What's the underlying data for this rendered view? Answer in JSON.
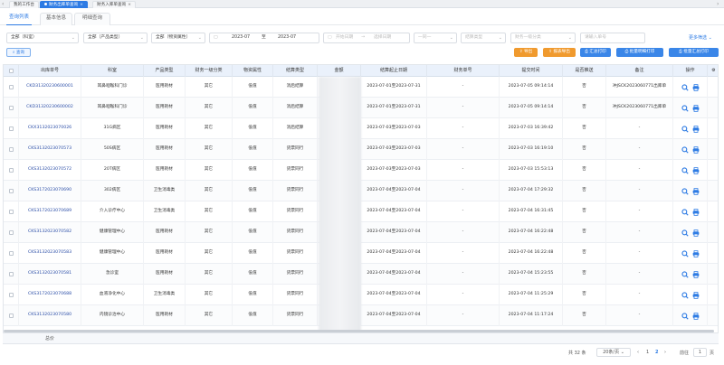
{
  "top_tabs": [
    {
      "label": "我的工作台"
    },
    {
      "label": "财务出库单查询"
    },
    {
      "label": "财务入库单查询"
    }
  ],
  "sub_tabs": [
    {
      "label": "查询列表"
    },
    {
      "label": "基本信息"
    },
    {
      "label": "明细查询"
    }
  ],
  "filters": {
    "dept": "全部（科室）",
    "product_type": "全部（产品类型）",
    "material": "全部（物资属性）",
    "date_from": "2023-07",
    "date_sep": "至",
    "date_to": "2023-07",
    "start_date_ph": "开始日期",
    "end_date_ph": "选择日期",
    "date_sep2": "→",
    "fuzzy_ph": "一同一",
    "settle_ph": "结算类型",
    "finance_cat_ph": "财务一级分类",
    "search_ph": "请输入单号",
    "more_filter": "更多筛选"
  },
  "actions": {
    "query": "查询",
    "export": "导出",
    "report_export": "报表导出",
    "summary_print": "汇总打印",
    "batch_detail_print": "批量明细打印",
    "batch_summary_print": "批量汇总打印"
  },
  "table": {
    "columns": [
      "出库单号",
      "科室",
      "产品类型",
      "财务一级分类",
      "物资属性",
      "结算类型",
      "金额",
      "结算起止日期",
      "财务单号",
      "提交时间",
      "是否推送",
      "备注",
      "操作"
    ],
    "rows": [
      {
        "no": "CKD31320230600001",
        "dept": "耳鼻咽喉科门诊",
        "ptype": "医用耗材",
        "fin": "其它",
        "attr": "低值",
        "settle": "消后结算",
        "range": "2023-07-01至2023-07-31",
        "finno": "-",
        "time": "2023-07-05 09:14:14",
        "push": "否",
        "remark": "冲JSCK2023060771出库单"
      },
      {
        "no": "CKD31320230600002",
        "dept": "耳鼻咽喉科门诊",
        "ptype": "医用耗材",
        "fin": "其它",
        "attr": "低值",
        "settle": "消后结算",
        "range": "2023-07-01至2023-07-31",
        "finno": "-",
        "time": "2023-07-05 09:14:14",
        "push": "否",
        "remark": "冲JSCK2023060771出库单"
      },
      {
        "no": "CKX3132023070026",
        "dept": "31G病区",
        "ptype": "医用耗材",
        "fin": "其它",
        "attr": "低值",
        "settle": "消后结算",
        "range": "2023-07-03至2023-07-03",
        "finno": "-",
        "time": "2023-07-03 16:39:42",
        "push": "否",
        "remark": "-"
      },
      {
        "no": "CKS3132023070573",
        "dept": "50S病区",
        "ptype": "医用耗材",
        "fin": "其它",
        "attr": "低值",
        "settle": "货票同行",
        "range": "2023-07-03至2023-07-03",
        "finno": "-",
        "time": "2023-07-03 16:19:10",
        "push": "否",
        "remark": "-"
      },
      {
        "no": "CKS3132023070572",
        "dept": "20T病区",
        "ptype": "医用耗材",
        "fin": "其它",
        "attr": "低值",
        "settle": "货票同行",
        "range": "2023-07-03至2023-07-03",
        "finno": "-",
        "time": "2023-07-03 15:53:13",
        "push": "否",
        "remark": "-"
      },
      {
        "no": "CKS3172023070690",
        "dept": "302病区",
        "ptype": "卫生消毒类",
        "fin": "其它",
        "attr": "低值",
        "settle": "货票同行",
        "range": "2023-07-04至2023-07-04",
        "finno": "-",
        "time": "2023-07-04 17:29:32",
        "push": "否",
        "remark": "-"
      },
      {
        "no": "CKS3172023070689",
        "dept": "介入诊疗中心",
        "ptype": "卫生消毒类",
        "fin": "其它",
        "attr": "低值",
        "settle": "货票同行",
        "range": "2023-07-04至2023-07-04",
        "finno": "-",
        "time": "2023-07-04 16:31:45",
        "push": "否",
        "remark": "-"
      },
      {
        "no": "CKS3132023070582",
        "dept": "健康管理中心",
        "ptype": "医用耗材",
        "fin": "其它",
        "attr": "低值",
        "settle": "货票同行",
        "range": "2023-07-04至2023-07-04",
        "finno": "-",
        "time": "2023-07-04 16:22:48",
        "push": "否",
        "remark": "-"
      },
      {
        "no": "CKS3132023070583",
        "dept": "健康管理中心",
        "ptype": "医用耗材",
        "fin": "其它",
        "attr": "低值",
        "settle": "货票同行",
        "range": "2023-07-04至2023-07-04",
        "finno": "-",
        "time": "2023-07-04 16:22:48",
        "push": "否",
        "remark": "-"
      },
      {
        "no": "CKS3132023070581",
        "dept": "急诊室",
        "ptype": "医用耗材",
        "fin": "其它",
        "attr": "低值",
        "settle": "货票同行",
        "range": "2023-07-04至2023-07-04",
        "finno": "-",
        "time": "2023-07-04 15:23:55",
        "push": "否",
        "remark": "-"
      },
      {
        "no": "CKS3172023070688",
        "dept": "血液净化中心",
        "ptype": "卫生消毒类",
        "fin": "其它",
        "attr": "低值",
        "settle": "货票同行",
        "range": "2023-07-04至2023-07-04",
        "finno": "-",
        "time": "2023-07-04 11:25:29",
        "push": "否",
        "remark": "-"
      },
      {
        "no": "CKS3132023070580",
        "dept": "内镜诊治中心",
        "ptype": "医用耗材",
        "fin": "其它",
        "attr": "低值",
        "settle": "货票同行",
        "range": "2023-07-04至2023-07-04",
        "finno": "-",
        "time": "2023-07-04 11:17:24",
        "push": "否",
        "remark": "-"
      }
    ],
    "total_label": "总价"
  },
  "pagination": {
    "total": "共 32 条",
    "page_size": "20条/页",
    "prev": "‹",
    "page1": "1",
    "page2": "2",
    "next": "›",
    "goto_label": "前往",
    "goto_value": "1",
    "page_unit": "页"
  },
  "colors": {
    "accent": "#2d7be4",
    "orange": "#f09a2e",
    "header_bg": "#eaf1fb"
  },
  "icons": [
    "search-icon",
    "print-icon",
    "gear-icon",
    "close-icon",
    "chevron-down-icon",
    "calendar-icon"
  ]
}
